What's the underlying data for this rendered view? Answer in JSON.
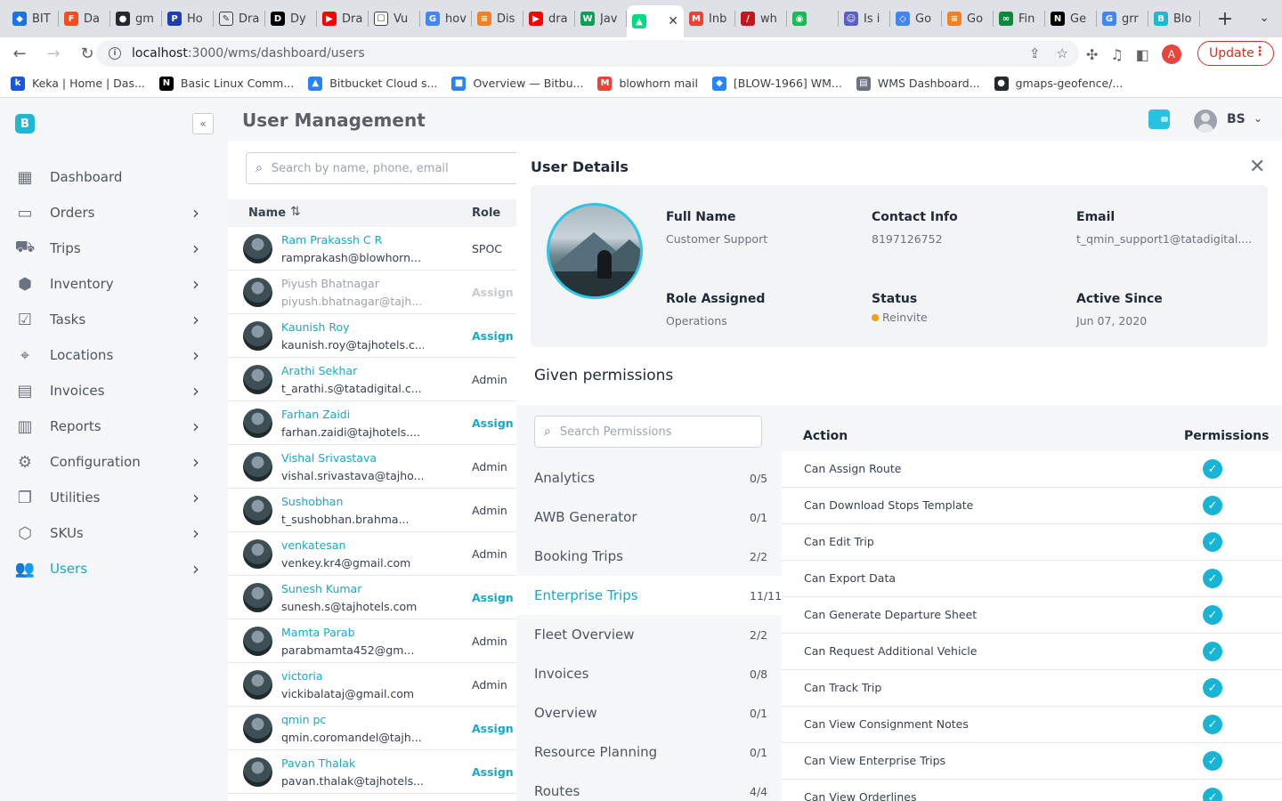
{
  "browser": {
    "tabs": [
      {
        "label": "BIT",
        "color": "#1a73e8",
        "glyph": "◆"
      },
      {
        "label": "Da",
        "color": "#f24e1e",
        "glyph": "F"
      },
      {
        "label": "gm",
        "color": "#24292e",
        "glyph": "●"
      },
      {
        "label": "Ho",
        "color": "#1e40af",
        "glyph": "P"
      },
      {
        "label": "Dra",
        "color": "#e5e7eb",
        "glyph": "✎"
      },
      {
        "label": "Dy",
        "color": "#000000",
        "glyph": "D"
      },
      {
        "label": "Dra",
        "color": "#ff0000",
        "glyph": "▶"
      },
      {
        "label": "Vu",
        "color": "#ffffff",
        "glyph": "☐"
      },
      {
        "label": "hov",
        "color": "#4285f4",
        "glyph": "G"
      },
      {
        "label": "Dis",
        "color": "#f48024",
        "glyph": "≡"
      },
      {
        "label": "dra",
        "color": "#ff0000",
        "glyph": "▶"
      },
      {
        "label": "Jav",
        "color": "#0f9d58",
        "glyph": "W"
      },
      {
        "label": "",
        "color": "#00dc82",
        "glyph": "▲",
        "active": true
      },
      {
        "label": "Inb",
        "color": "#ea4335",
        "glyph": "M"
      },
      {
        "label": "wh",
        "color": "#c4161c",
        "glyph": "/"
      },
      {
        "label": "",
        "color": "#1db954",
        "glyph": "◉"
      },
      {
        "label": "Is i",
        "color": "#5b5fc7",
        "glyph": "☺"
      },
      {
        "label": "Go",
        "color": "#4285f4",
        "glyph": "◇"
      },
      {
        "label": "Go",
        "color": "#f48024",
        "glyph": "≡"
      },
      {
        "label": "Fin",
        "color": "#0a8a3a",
        "glyph": "∞"
      },
      {
        "label": "Ge",
        "color": "#000000",
        "glyph": "N"
      },
      {
        "label": "grr",
        "color": "#4285f4",
        "glyph": "G"
      },
      {
        "label": "Blo",
        "color": "#23b6d2",
        "glyph": "B"
      }
    ],
    "url_host": "localhost",
    "url_path": ":3000/wms/dashboard/users",
    "profile_initial": "A",
    "update_label": "Update",
    "bookmarks": [
      {
        "label": "Keka | Home | Das...",
        "color": "#1a56db",
        "glyph": "k"
      },
      {
        "label": "Basic Linux Comm...",
        "color": "#000000",
        "glyph": "N"
      },
      {
        "label": "Bitbucket Cloud s...",
        "color": "#2684ff",
        "glyph": "▲"
      },
      {
        "label": "Overview — Bitbu...",
        "color": "#2684ff",
        "glyph": "■"
      },
      {
        "label": "blowhorn mail",
        "color": "#ea4335",
        "glyph": "M"
      },
      {
        "label": "[BLOW-1966] WM...",
        "color": "#2684ff",
        "glyph": "◆"
      },
      {
        "label": "WMS Dashboard...",
        "color": "#6b7280",
        "glyph": "▤"
      },
      {
        "label": "gmaps-geofence/...",
        "color": "#24292e",
        "glyph": "●"
      }
    ]
  },
  "app": {
    "page_title": "User Management",
    "user_initials": "BS",
    "sidebar": [
      {
        "label": "Dashboard",
        "icon": "dashboard-icon",
        "glyph": "▦",
        "chevron": false
      },
      {
        "label": "Orders",
        "icon": "orders-icon",
        "glyph": "▭",
        "chevron": true
      },
      {
        "label": "Trips",
        "icon": "truck-icon",
        "glyph": "⛟",
        "chevron": true
      },
      {
        "label": "Inventory",
        "icon": "boxes-icon",
        "glyph": "⬢",
        "chevron": true
      },
      {
        "label": "Tasks",
        "icon": "tasks-icon",
        "glyph": "☑",
        "chevron": true
      },
      {
        "label": "Locations",
        "icon": "location-icon",
        "glyph": "⌖",
        "chevron": true
      },
      {
        "label": "Invoices",
        "icon": "invoice-icon",
        "glyph": "▤",
        "chevron": true
      },
      {
        "label": "Reports",
        "icon": "reports-icon",
        "glyph": "▥",
        "chevron": true
      },
      {
        "label": "Configuration",
        "icon": "gear-icon",
        "glyph": "⚙",
        "chevron": true
      },
      {
        "label": "Utilities",
        "icon": "utilities-icon",
        "glyph": "❐",
        "chevron": true
      },
      {
        "label": "SKUs",
        "icon": "sku-icon",
        "glyph": "⬡",
        "chevron": true
      },
      {
        "label": "Users",
        "icon": "users-icon",
        "glyph": "👥",
        "chevron": true,
        "active": true
      }
    ],
    "search_placeholder": "Search by name, phone, email",
    "list_headers": {
      "name": "Name",
      "role": "Role"
    },
    "users": [
      {
        "name": "Ram Prakassh C R",
        "email": "ramprakash@blowhorn...",
        "role": "SPOC",
        "assign": false
      },
      {
        "name": "Piyush Bhatnagar",
        "email": "piyush.bhatnagar@tajh...",
        "role": "Assign R",
        "assign": true,
        "dim": true
      },
      {
        "name": "Kaunish Roy",
        "email": "kaunish.roy@tajhotels.c...",
        "role": "Assign R",
        "assign": true
      },
      {
        "name": "Arathi Sekhar",
        "email": "t_arathi.s@tatadigital.c...",
        "role": "Admin",
        "assign": false
      },
      {
        "name": "Farhan Zaidi",
        "email": "farhan.zaidi@tajhotels....",
        "role": "Assign R",
        "assign": true
      },
      {
        "name": "Vishal Srivastava",
        "email": "vishal.srivastava@tajho...",
        "role": "Admin",
        "assign": false
      },
      {
        "name": "Sushobhan",
        "email": "t_sushobhan.brahma...",
        "role": "Admin",
        "assign": false
      },
      {
        "name": "venkatesan",
        "email": "venkey.kr4@gmail.com",
        "role": "Admin",
        "assign": false
      },
      {
        "name": "Sunesh Kumar",
        "email": "sunesh.s@tajhotels.com",
        "role": "Assign R",
        "assign": true
      },
      {
        "name": "Mamta Parab",
        "email": "parabmamta452@gm...",
        "role": "Admin",
        "assign": false
      },
      {
        "name": "victoria",
        "email": "vickibalataj@gmail.com",
        "role": "Admin",
        "assign": false
      },
      {
        "name": "qmin pc",
        "email": "qmin.coromandel@tajh...",
        "role": "Assign R",
        "assign": true
      },
      {
        "name": "Pavan Thalak",
        "email": "pavan.thalak@tajhotels...",
        "role": "Assign R",
        "assign": true
      }
    ],
    "details": {
      "title": "User Details",
      "full_name_label": "Full Name",
      "full_name": "Customer Support",
      "contact_label": "Contact Info",
      "contact": "8197126752",
      "email_label": "Email",
      "email": "t_qmin_support1@tatadigital....",
      "role_label": "Role Assigned",
      "role": "Operations",
      "status_label": "Status",
      "status": "Reinvite",
      "status_color": "#f59e0b",
      "active_label": "Active Since",
      "active_since": "Jun 07, 2020",
      "permissions_title": "Given permissions",
      "perm_search_placeholder": "Search Permissions",
      "categories": [
        {
          "name": "Analytics",
          "count": "0/5"
        },
        {
          "name": "AWB Generator",
          "count": "0/1"
        },
        {
          "name": "Booking Trips",
          "count": "2/2"
        },
        {
          "name": "Enterprise Trips",
          "count": "11/11",
          "active": true
        },
        {
          "name": "Fleet Overview",
          "count": "2/2"
        },
        {
          "name": "Invoices",
          "count": "0/8"
        },
        {
          "name": "Overview",
          "count": "0/1"
        },
        {
          "name": "Resource Planning",
          "count": "0/1"
        },
        {
          "name": "Routes",
          "count": "4/4"
        }
      ],
      "action_header": "Action",
      "permissions_header": "Permissions",
      "actions": [
        "Can Assign Route",
        "Can Download Stops Template",
        "Can Edit Trip",
        "Can Export Data",
        "Can Generate Departure Sheet",
        "Can Request Additional Vehicle",
        "Can Track Trip",
        "Can View Consignment Notes",
        "Can View Enterprise Trips",
        "Can View Orderlines"
      ]
    }
  }
}
